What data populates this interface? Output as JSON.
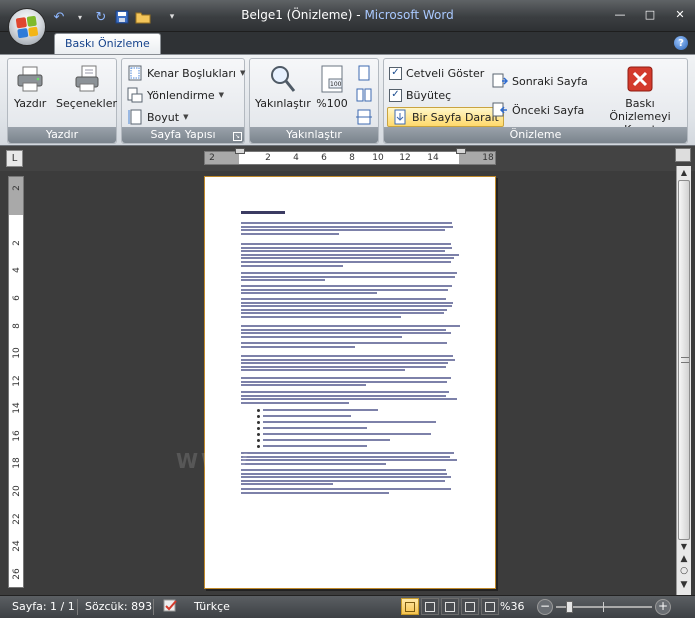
{
  "window": {
    "document_name": "Belge1 (Önizleme)",
    "separator": " - ",
    "app_name": "Microsoft Word",
    "minimize": "—",
    "maximize": "□",
    "close": "✕"
  },
  "quick_access": {
    "undo": "↶",
    "redo": "↻",
    "save": "▪",
    "open": "▭",
    "customize": "▾"
  },
  "ribbon": {
    "active_tab": "Baskı Önizleme",
    "help": "?",
    "groups": {
      "print": {
        "label": "Yazdır",
        "print_button": "Yazdır",
        "options_button": "Seçenekler"
      },
      "page_setup": {
        "label": "Sayfa Yapısı",
        "margins": "Kenar Boşlukları",
        "orientation": "Yönlendirme",
        "size": "Boyut"
      },
      "zoom": {
        "label": "Yakınlaştır",
        "zoom_button": "Yakınlaştır",
        "percent_button": "%100",
        "percent_icon_text": "100"
      },
      "preview": {
        "label": "Önizleme",
        "show_ruler": "Cetveli Göster",
        "show_ruler_checked": true,
        "magnifier": "Büyüteç",
        "magnifier_checked": true,
        "shrink_one_page": "Bir Sayfa Daralt",
        "next_page": "Sonraki Sayfa",
        "previous_page": "Önceki Sayfa",
        "close_preview": "Baskı Önizlemeyi Kapat"
      }
    }
  },
  "ruler": {
    "toggle": "L",
    "h_ticks": [
      "2",
      "2",
      "4",
      "6",
      "8",
      "10",
      "12",
      "14",
      "18"
    ],
    "v_ticks": [
      "2",
      "2",
      "4",
      "6",
      "8",
      "10",
      "12",
      "14",
      "16",
      "18",
      "20",
      "22",
      "24",
      "26"
    ]
  },
  "document": {
    "watermark": "WWW"
  },
  "statusbar": {
    "page": "Sayfa: 1 / 1",
    "words": "Sözcük: 893",
    "language": "Türkçe",
    "zoom": "%36",
    "zoom_minus": "−",
    "zoom_plus": "+"
  },
  "colors": {
    "titlebar": "#3b3e41",
    "ribbon": "#e6e9ed",
    "workspace": "#3c3c3c",
    "highlight": "#ffd96b",
    "close_red": "#d33a2c"
  }
}
